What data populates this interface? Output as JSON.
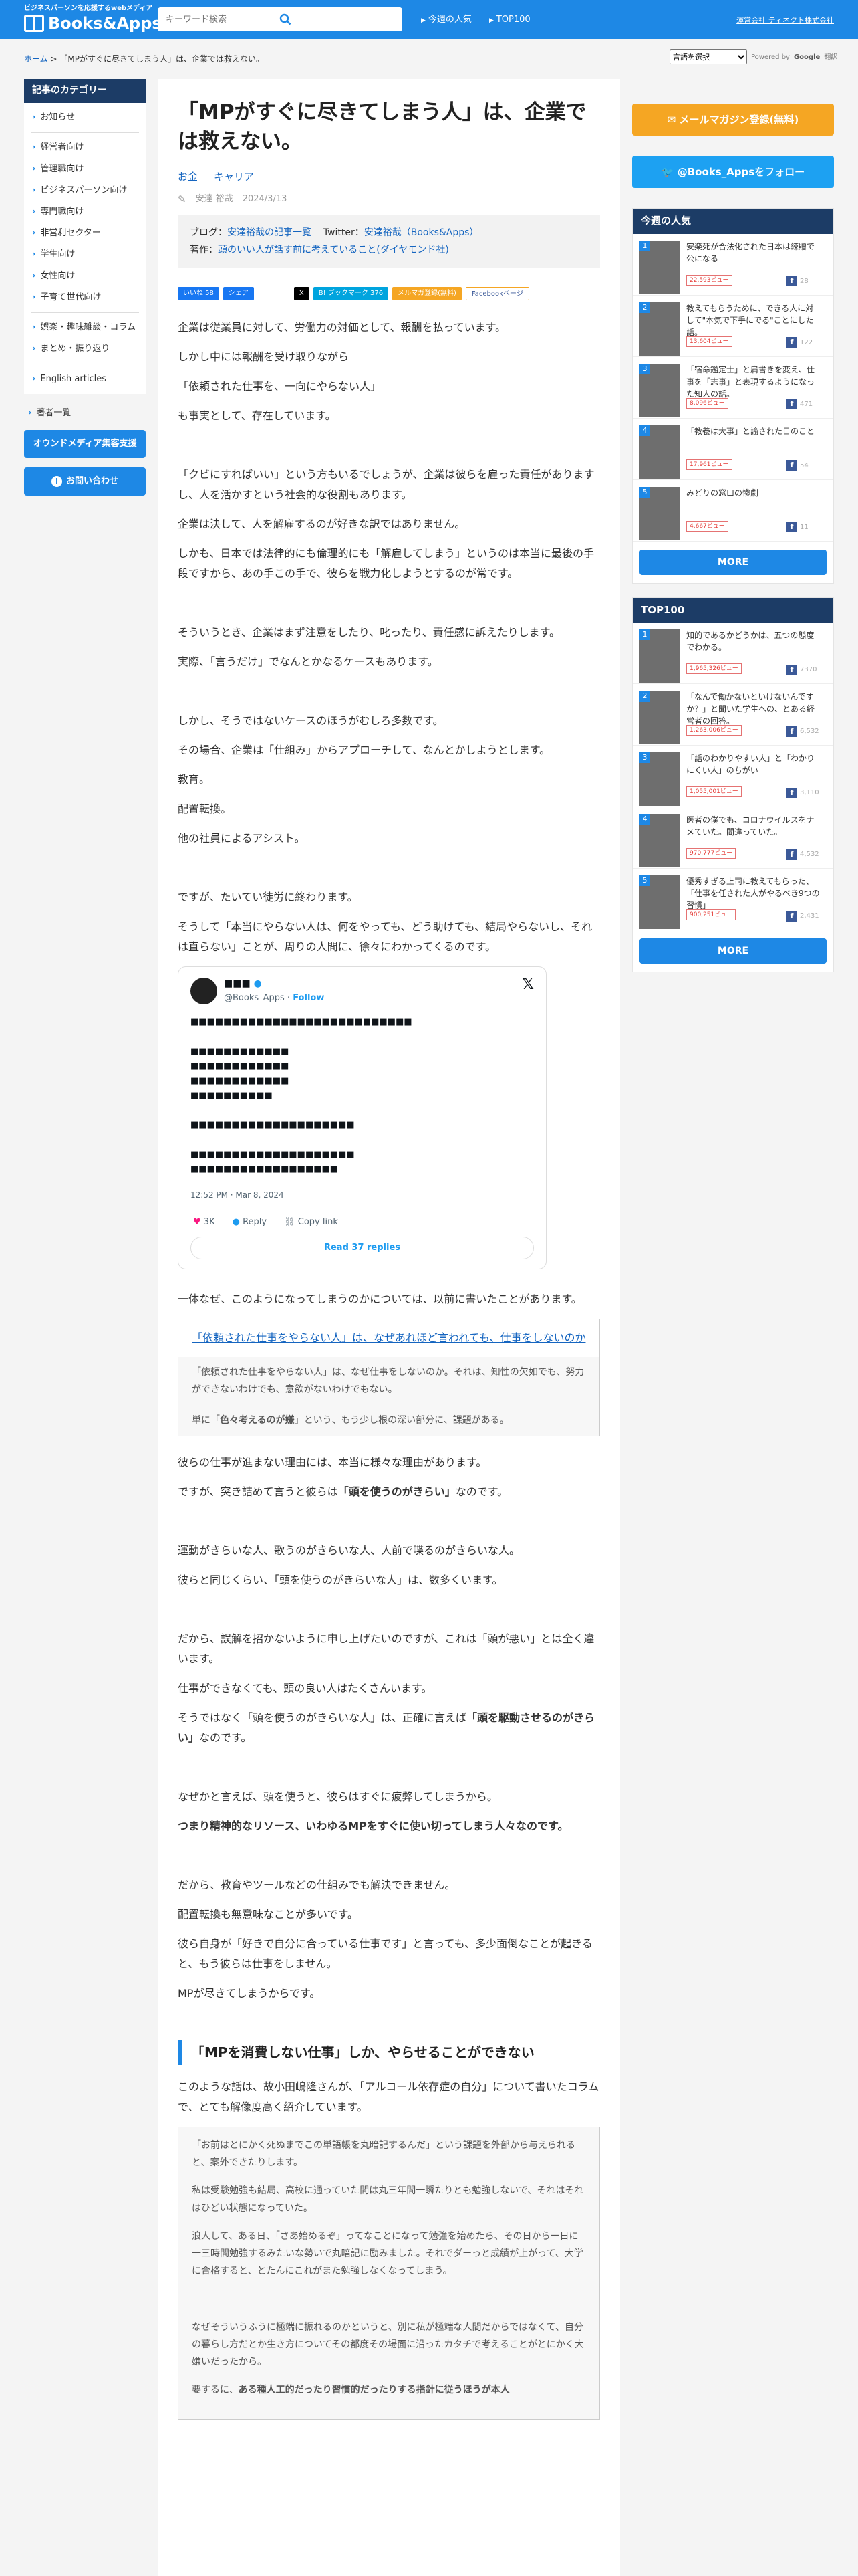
{
  "header": {
    "tagline": "ビジネスパーソンを応援するwebメディア",
    "site_name": "Books&Apps",
    "search_placeholder": "キーワード検索",
    "nav": [
      "今週の人気",
      "TOP100"
    ],
    "company_link": "運営会社 ティネクト株式会社"
  },
  "breadcrumb": {
    "home": "ホーム",
    "sep": ">",
    "current": "「MPがすぐに尽きてしまう人」は、企業では救えない。"
  },
  "translate": {
    "select_label": "言語を選択",
    "powered": "Powered by",
    "google": "Google",
    "translate": "翻訳"
  },
  "sidebar": {
    "heading": "記事のカテゴリー",
    "group1": [
      "お知らせ"
    ],
    "group2": [
      "経営者向け",
      "管理職向け",
      "ビジネスパーソン向け",
      "専門職向け",
      "非営利セクター",
      "学生向け",
      "女性向け",
      "子育て世代向け"
    ],
    "group3": [
      "娯楽・趣味雑談・コラム",
      "まとめ・振り返り"
    ],
    "group4": [
      "English articles"
    ],
    "authors": "著者一覧",
    "owned_media": "オウンドメディア集客支援",
    "contact": "お問い合わせ"
  },
  "article": {
    "title": "「MPがすぐに尽きてしまう人」は、企業では救えない。",
    "tags": [
      "お金",
      "キャリア"
    ],
    "author": "安達 裕哉",
    "date": "2024/3/13",
    "info_blog_label": "ブログ：",
    "info_blog_link": "安達裕哉の記事一覧",
    "info_twitter_label": "Twitter：",
    "info_twitter_link": "安達裕哉（Books&Apps）",
    "info_book_label": "著作：",
    "info_book_link": "頭のいい人が話す前に考えていること(ダイヤモンド社)",
    "share": {
      "like": "いいね 58",
      "share": "シェア",
      "tweet": "X",
      "hatena": "B! ブックマーク 376",
      "mail": "メルマガ登録(無料)",
      "facebook": "Facebookページ"
    },
    "paras1": [
      "企業は従業員に対して、労働力の対価として、報酬を払っています。",
      "しかし中には報酬を受け取りながら",
      "「依頼された仕事を、一向にやらない人」",
      "も事実として、存在しています。"
    ],
    "paras2": [
      "「クビにすればいい」という方もいるでしょうが、企業は彼らを雇った責任がありますし、人を活かすという社会的な役割もあります。",
      "企業は決して、人を解雇するのが好きな訳ではありません。",
      "しかも、日本では法律的にも倫理的にも「解雇してしまう」というのは本当に最後の手段ですから、あの手この手で、彼らを戦力化しようとするのが常です。"
    ],
    "paras3": [
      "そういうとき、企業はまず注意をしたり、叱ったり、責任感に訴えたりします。",
      "実際、「言うだけ」でなんとかなるケースもあります。"
    ],
    "paras4": [
      "しかし、そうではないケースのほうがむしろ多数です。",
      "その場合、企業は「仕組み」からアプローチして、なんとかしようとします。",
      "教育。",
      "配置転換。",
      "他の社員によるアシスト。"
    ],
    "paras5": [
      "ですが、たいてい徒労に終わります。",
      "そうして「本当にやらない人は、何をやっても、どう助けても、結局やらないし、それは直らない」ことが、周りの人間に、徐々にわかってくるのです。"
    ],
    "tweet": {
      "name": "■■■",
      "handle": "@Books_Apps",
      "follow": "Follow",
      "lines": [
        "■■■■■■■■■■■■■■■■■■■■■■■■■■■",
        "",
        "■■■■■■■■■■■■",
        "■■■■■■■■■■■■",
        "■■■■■■■■■■■■",
        "■■■■■■■■■■",
        "",
        "■■■■■■■■■■■■■■■■■■■■",
        "",
        "■■■■■■■■■■■■■■■■■■■■",
        "■■■■■■■■■■■■■■■■■■"
      ],
      "time": "12:52 PM · Mar 8, 2024",
      "likes": "3K",
      "reply": "Reply",
      "copy": "Copy link",
      "read": "Read 37 replies"
    },
    "para_after_tweet": "一体なぜ、このようになってしまうのかについては、以前に書いたことがあります。",
    "quote": {
      "link": "「依頼された仕事をやらない人」は、なぜあれほど言われても、仕事をしないのか",
      "body1": "「依頼された仕事をやらない人」は、なぜ仕事をしないのか。それは、知性の欠如でも、努力ができないわけでも、意欲がないわけでもない。",
      "body2_pre": "単に「",
      "body2_bold": "色々考えるのが嫌",
      "body2_post": "」という、もう少し根の深い部分に、課題がある。"
    },
    "paras6_1": "彼らの仕事が進まない理由には、本当に様々な理由があります。",
    "paras6_2_pre": "ですが、突き詰めて言うと彼らは",
    "paras6_2_bold": "「頭を使うのがきらい」",
    "paras6_2_post": "なのです。",
    "paras7": [
      "運動がきらいな人、歌うのがきらいな人、人前で喋るのがきらいな人。",
      "彼らと同じくらい、「頭を使うのがきらいな人」は、数多くいます。"
    ],
    "paras8_1": "だから、誤解を招かないように申し上げたいのですが、これは「頭が悪い」とは全く違います。",
    "paras8_2": "仕事ができなくても、頭の良い人はたくさんいます。",
    "paras8_3_pre": "そうではなく「頭を使うのがきらいな人」は、正確に言えば",
    "paras8_3_bold": "「頭を駆動させるのがきらい」",
    "paras8_3_post": "なのです。",
    "paras9_1": "なぜかと言えば、頭を使うと、彼らはすぐに疲弊してしまうから。",
    "paras9_2": "つまり精神的なリソース、いわゆるMPをすぐに使い切ってしまう人々なのです。",
    "paras10": [
      "だから、教育やツールなどの仕組みでも解決できません。",
      "配置転換も無意味なことが多いです。",
      "彼ら自身が「好きで自分に合っている仕事です」と言っても、多少面倒なことが起きると、もう彼らは仕事をしません。",
      "MPが尽きてしまうからです。"
    ],
    "h2": "「MPを消費しない仕事」しか、やらせることができない",
    "para_h2": "このような話は、故小田嶋隆さんが、「アルコール依存症の自分」について書いたコラムで、とても解像度高く紹介しています。",
    "cite": [
      "「お前はとにかく死ぬまでこの単語帳を丸暗記するんだ」という課題を外部から与えられると、案外できたりします。",
      "私は受験勉強も結局、高校に通っていた間は丸三年間一瞬たりとも勉強しないで、それはそれはひどい状態になっていた。",
      "浪人して、ある日、「さあ始めるぞ」ってなことになって勉強を始めたら、その日から一日に一三時間勉強するみたいな勢いで丸暗記に励みました。それでダーっと成績が上がって、大学に合格すると、とたんにこれがまた勉強しなくなってしまう。",
      "",
      "なぜそういうふうに極端に振れるのかというと、別に私が極端な人間だからではなくて、自分の暮らし方だとか生き方についてその都度その場面に沿ったカタチで考えることがとにかく大嫌いだったから。"
    ],
    "cite_last_pre": "要するに、",
    "cite_last_bold": "ある種人工的だったり習慣的だったりする指針に従うほうが本人"
  },
  "right": {
    "mail_btn": "メールマガジン登録(無料)",
    "follow_btn": "@Books_Appsをフォロー",
    "weekly_heading": "今週の人気",
    "weekly": [
      {
        "no": "1",
        "title": "安楽死が合法化された日本は練贈で公になる",
        "views": "22,593ビュー",
        "fb": "28"
      },
      {
        "no": "2",
        "title": "教えてもらうために、できる人に対して\"本気で下手にでる\"ことにした話。",
        "views": "13,604ビュー",
        "fb": "122"
      },
      {
        "no": "3",
        "title": "「宿命鑑定士」と肩書きを変え、仕事を「志事」と表現するようになった知人の話。",
        "views": "8,096ビュー",
        "fb": "471"
      },
      {
        "no": "4",
        "title": "「教養は大事」と諭された日のこと",
        "views": "17,961ビュー",
        "fb": "54"
      },
      {
        "no": "5",
        "title": "みどりの窓口の惨劇",
        "views": "4,667ビュー",
        "fb": "11"
      }
    ],
    "more": "MORE",
    "top_heading": "TOP100",
    "top": [
      {
        "no": "1",
        "title": "知的であるかどうかは、五つの態度でわかる。",
        "views": "1,965,326ビュー",
        "fb": "7370"
      },
      {
        "no": "2",
        "title": "「なんで働かないといけないんですか？」と聞いた学生への、とある経営者の回答。",
        "views": "1,263,006ビュー",
        "fb": "6,532"
      },
      {
        "no": "3",
        "title": "「話のわかりやすい人」と「わかりにくい人」のちがい",
        "views": "1,055,001ビュー",
        "fb": "3,110"
      },
      {
        "no": "4",
        "title": "医者の僕でも、コロナウイルスをナメていた。間違っていた。",
        "views": "970,777ビュー",
        "fb": "4,532"
      },
      {
        "no": "5",
        "title": "優秀すぎる上司に教えてもらった、「仕事を任された人がやるべき9つの習慣」",
        "views": "900,251ビュー",
        "fb": "2,431"
      }
    ],
    "more2": "MORE"
  },
  "colors": {
    "primary": "#1e88e5",
    "navy": "#1c3c66",
    "mail": "#f5a623",
    "twitter": "#1da1f2"
  }
}
